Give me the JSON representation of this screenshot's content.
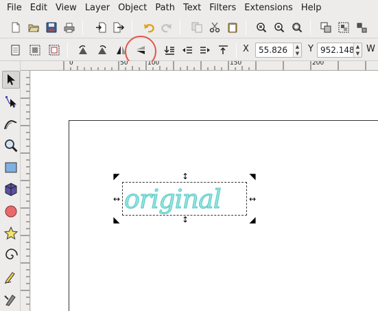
{
  "menu": {
    "items": [
      "File",
      "Edit",
      "View",
      "Layer",
      "Object",
      "Path",
      "Text",
      "Filters",
      "Extensions",
      "Help"
    ]
  },
  "controls": {
    "x_label": "X",
    "x_value": "55.826",
    "y_label": "Y",
    "y_value": "952.148",
    "w_label": "W"
  },
  "ruler": {
    "top_ticks": [
      "0",
      "50",
      "100",
      "150",
      "200"
    ],
    "left_ticks": [
      "1",
      "0",
      "0",
      "0",
      "0",
      "1",
      "5",
      "0",
      "2",
      "0",
      "0",
      "2",
      "5",
      "0",
      "3",
      "0",
      "0"
    ]
  },
  "canvas": {
    "text_object": "original"
  },
  "colors": {
    "text_fill": "#7fe0dc",
    "highlight": "#e2574c"
  }
}
